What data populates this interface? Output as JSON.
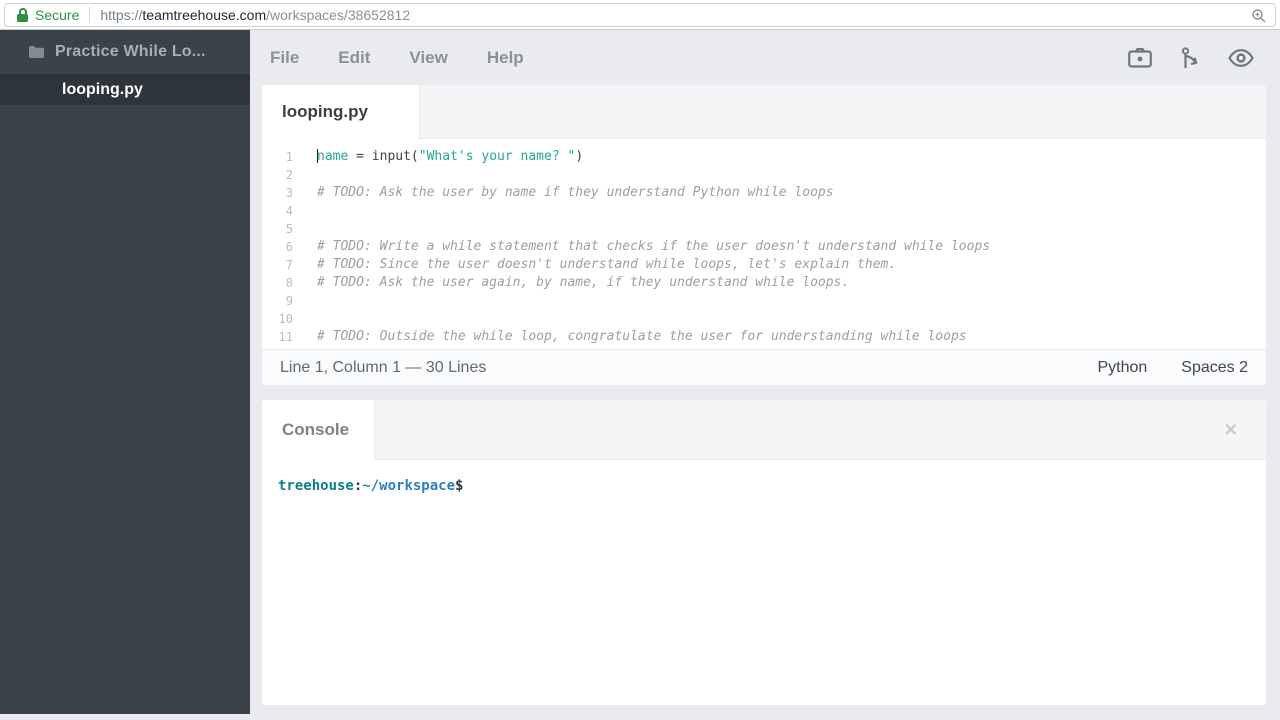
{
  "browser": {
    "security_label": "Secure",
    "url_scheme": "https://",
    "url_domain": "teamtreehouse.com",
    "url_path": "/workspaces/38652812"
  },
  "sidebar": {
    "folder_label": "Practice While Lo...",
    "files": [
      {
        "name": "looping.py",
        "selected": true
      }
    ]
  },
  "menubar": {
    "items": [
      {
        "label": "File"
      },
      {
        "label": "Edit"
      },
      {
        "label": "View"
      },
      {
        "label": "Help"
      }
    ],
    "icons": [
      "camera-icon",
      "fork-icon",
      "eye-icon"
    ]
  },
  "editor": {
    "tab_label": "looping.py",
    "code_lines": [
      {
        "number": "1",
        "caret": true,
        "segments": [
          {
            "text": "name",
            "type": "variable"
          },
          {
            "text": " = input(",
            "type": "plain"
          },
          {
            "text": "\"What's your name? \"",
            "type": "string"
          },
          {
            "text": ")",
            "type": "plain"
          }
        ]
      },
      {
        "number": "2",
        "segments": []
      },
      {
        "number": "3",
        "segments": [
          {
            "text": "# TODO: Ask the user by name if they understand Python while loops",
            "type": "comment"
          }
        ]
      },
      {
        "number": "4",
        "segments": []
      },
      {
        "number": "5",
        "segments": []
      },
      {
        "number": "6",
        "segments": [
          {
            "text": "# TODO: Write a while statement that checks if the user doesn't understand while loops",
            "type": "comment"
          }
        ]
      },
      {
        "number": "7",
        "segments": [
          {
            "text": "# TODO: Since the user doesn't understand while loops, let's explain them.",
            "type": "comment"
          }
        ]
      },
      {
        "number": "8",
        "segments": [
          {
            "text": "# TODO: Ask the user again, by name, if they understand while loops.",
            "type": "comment"
          }
        ]
      },
      {
        "number": "9",
        "segments": []
      },
      {
        "number": "10",
        "segments": []
      },
      {
        "number": "11",
        "segments": [
          {
            "text": "# TODO: Outside the while loop, congratulate the user for understanding while loops",
            "type": "comment"
          }
        ]
      }
    ],
    "statusbar": {
      "position": "Line 1, Column 1 — 30 Lines",
      "language": "Python",
      "indent": "Spaces  2"
    }
  },
  "console": {
    "tab_label": "Console",
    "close_glyph": "✕",
    "prompt": {
      "user": "treehouse",
      "separator": ":",
      "path": "~/workspace",
      "symbol": "$"
    }
  },
  "colors": {
    "accent_teal": "#26a695",
    "secure_green": "#2f8f46",
    "sidebar_bg": "#3a424a",
    "prompt_user": "#0d7f8c",
    "prompt_path": "#2f7fc0"
  }
}
